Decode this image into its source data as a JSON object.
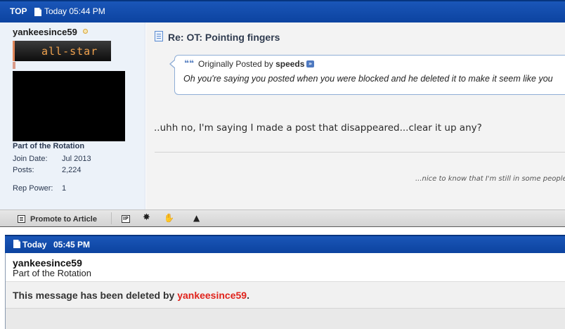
{
  "post1": {
    "header": {
      "top_label": "TOP",
      "date": "Today 05:44 PM"
    },
    "user": {
      "username": "yankeesince59",
      "rank_image_text": "all-star",
      "title": "Part of the Rotation",
      "join_date_label": "Join Date:",
      "join_date": "Jul 2013",
      "posts_label": "Posts:",
      "posts": "2,224",
      "rep_power_label": "Rep Power:",
      "rep_power": "1"
    },
    "title": "Re: OT: Pointing fingers",
    "quote": {
      "prefix": "Originally Posted by",
      "author": "speeds",
      "text": "Oh you're saying you posted when you were blocked and he deleted it to make it seem like you"
    },
    "body": "..uhh no, I'm saying I made a post that disappeared...clear it up any?",
    "signature": "...nice to know that I'm still in some people",
    "footer": {
      "promote_label": "Promote to Article"
    }
  },
  "post2": {
    "header": {
      "date": "Today",
      "time": "05:45 PM"
    },
    "username": "yankeesince59",
    "title": "Part of the Rotation",
    "deleted_prefix": "This message has been deleted by",
    "deleted_by": "yankeesince59",
    "deleted_suffix": "."
  },
  "colors": {
    "header_blue": "#1450b0",
    "deleted_by_red": "#e0231c"
  },
  "icons": [
    "document-icon",
    "online-status-icon",
    "post-icon",
    "quote-icon",
    "view-post-icon",
    "promote-icon",
    "ip-icon",
    "report-icon",
    "reputation-icon",
    "warning-icon"
  ]
}
